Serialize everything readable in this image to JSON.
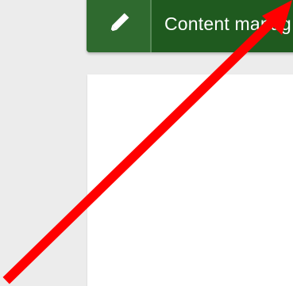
{
  "menu": {
    "label": "Content manag",
    "icon": "pencil-icon"
  },
  "colors": {
    "page_background": "#ececec",
    "menu_background": "#1f5a1f",
    "icon_background": "#2f6a2f",
    "card_background": "#ffffff",
    "arrow": "#ff0000"
  }
}
